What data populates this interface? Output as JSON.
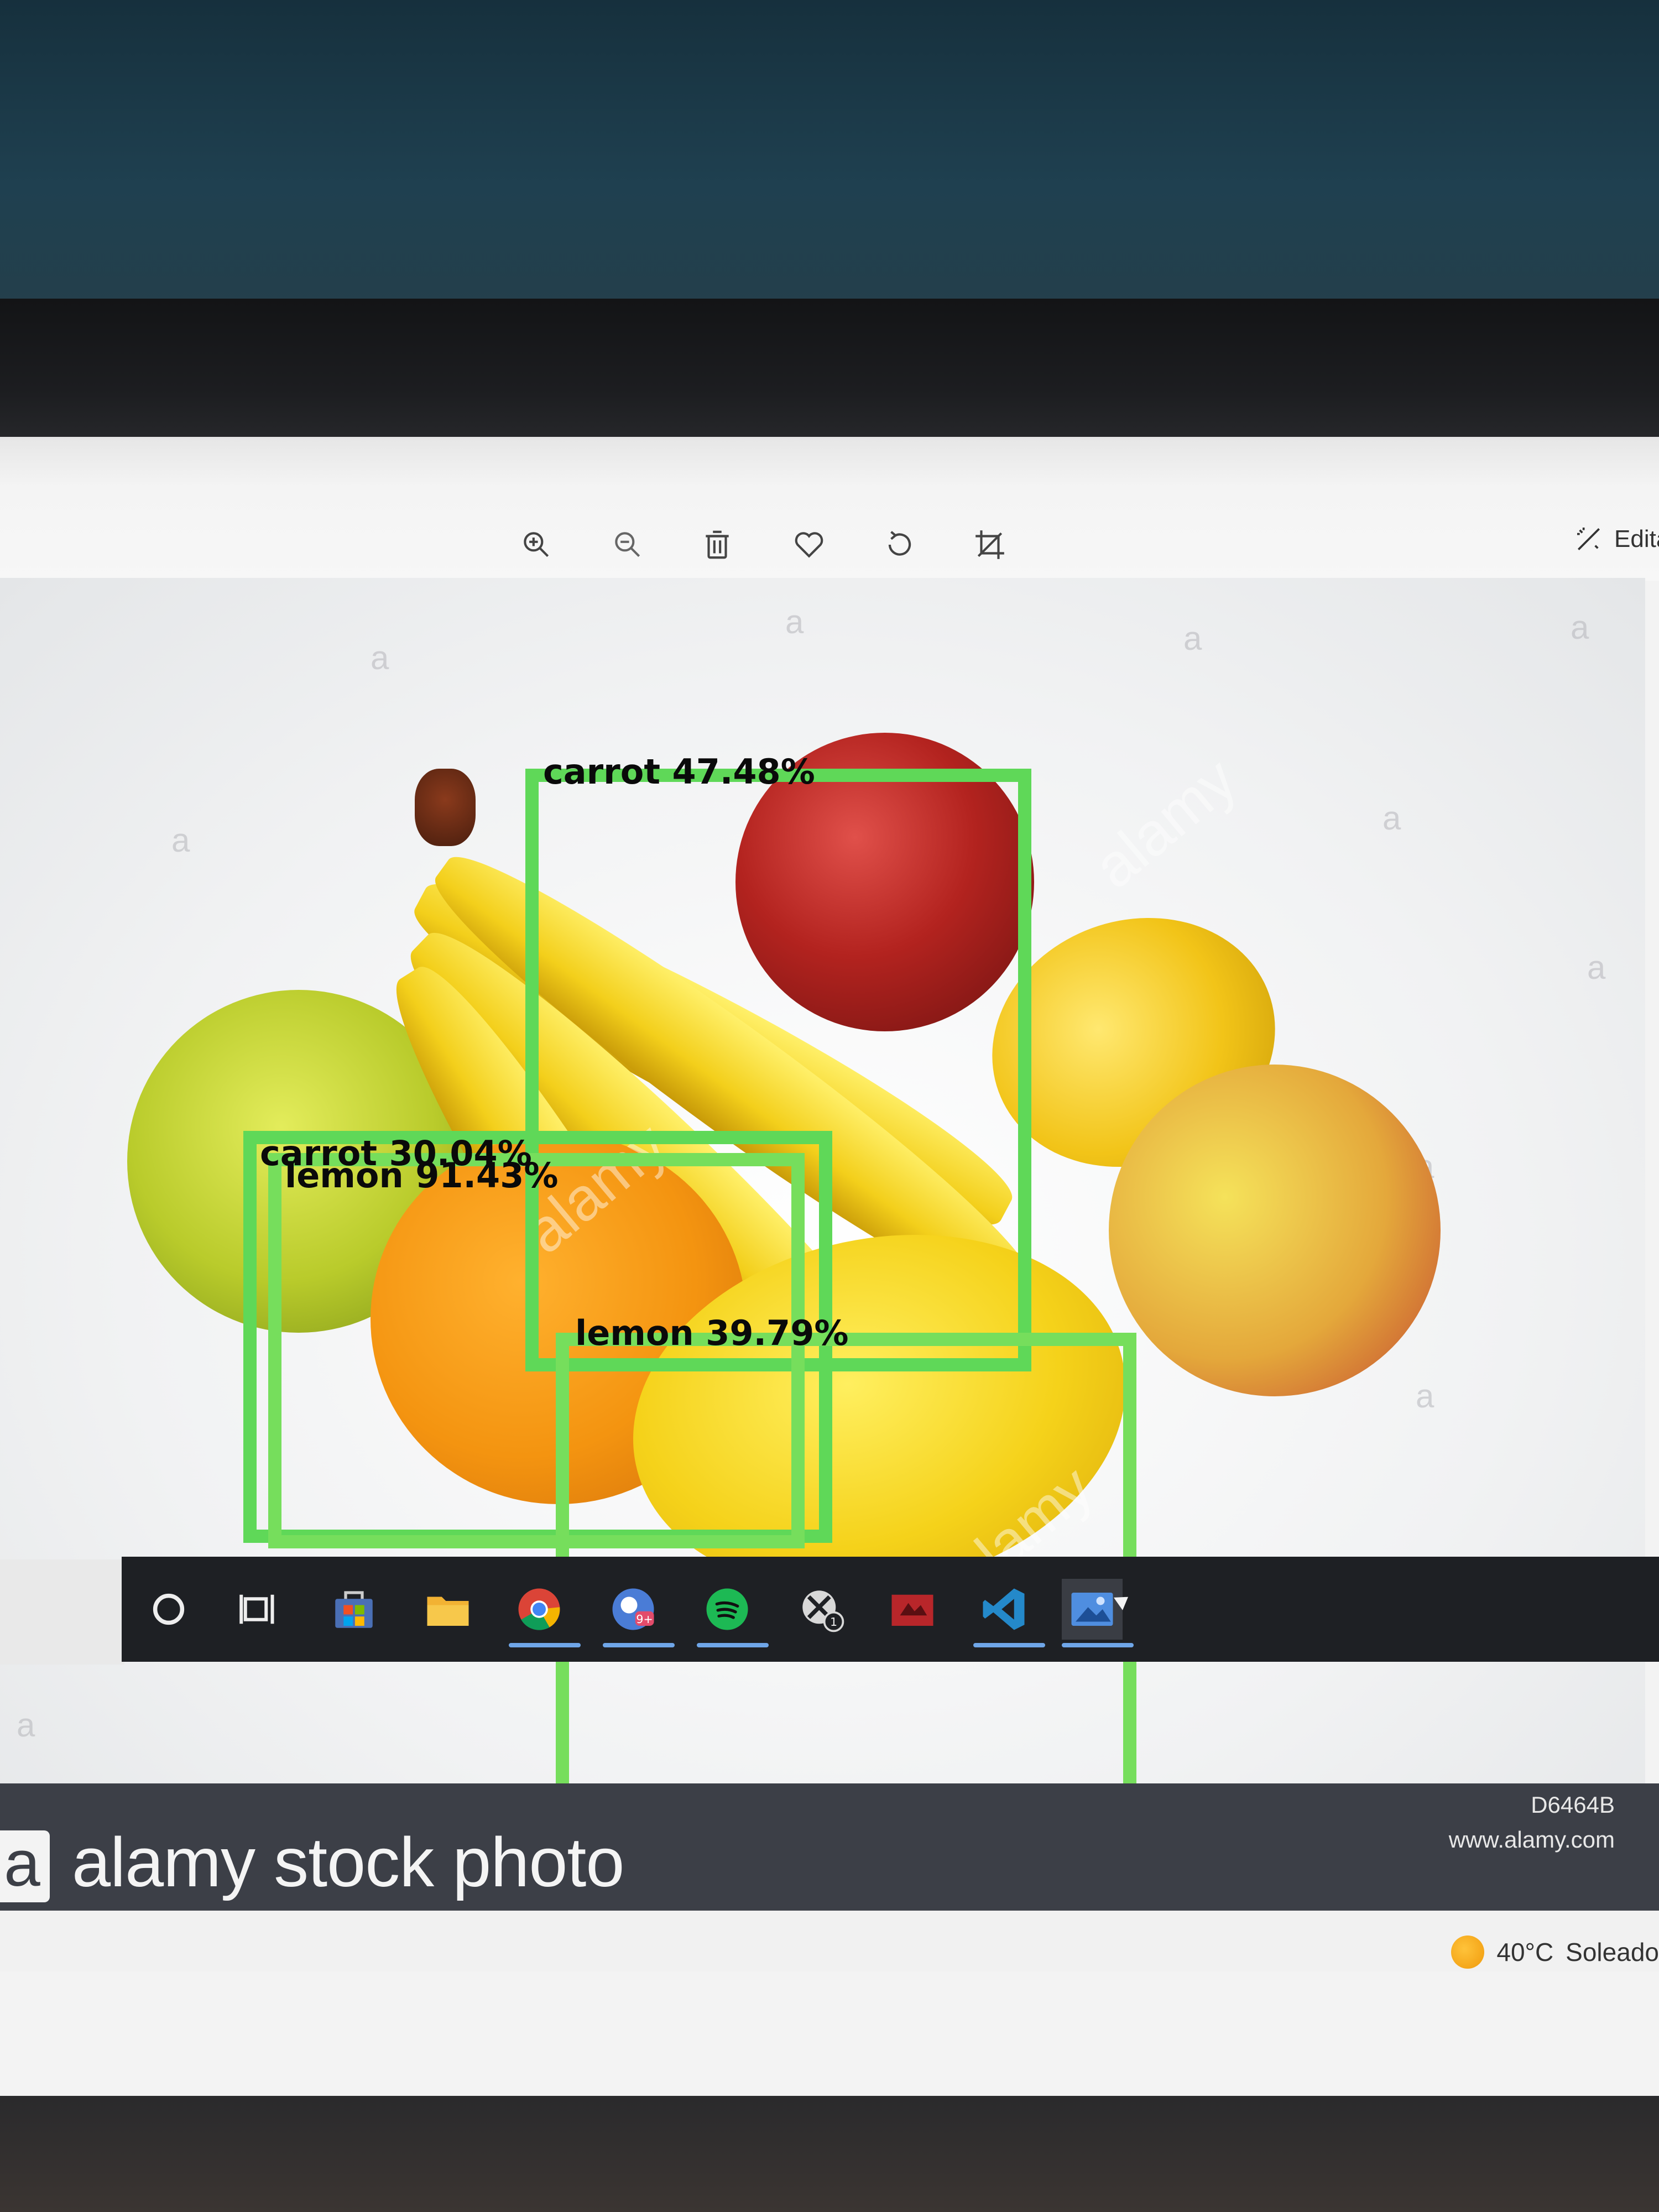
{
  "toolbar": {
    "tools": [
      {
        "name": "zoom-in-icon"
      },
      {
        "name": "zoom-out-icon"
      },
      {
        "name": "delete-icon"
      },
      {
        "name": "favorite-icon"
      },
      {
        "name": "rotate-icon"
      },
      {
        "name": "crop-icon"
      }
    ],
    "edit_label": "Edita"
  },
  "detections": [
    {
      "label": "carrot 47.48%"
    },
    {
      "label": "carrot 30.04%"
    },
    {
      "label": "lemon 91.43%"
    },
    {
      "label": "lemon 39.79%"
    }
  ],
  "watermark": {
    "letter": "a",
    "brand": "alamy"
  },
  "banner": {
    "logo_letter": "a",
    "text": "alamy stock photo",
    "image_id": "D6464B",
    "url": "www.alamy.com"
  },
  "weather": {
    "temperature": "40°C",
    "condition": "Soleado"
  },
  "taskbar": {
    "items": [
      {
        "name": "cortana-icon"
      },
      {
        "name": "task-view-icon"
      },
      {
        "name": "store-icon"
      },
      {
        "name": "file-explorer-icon"
      },
      {
        "name": "chrome-icon"
      },
      {
        "name": "chrome-profile-icon",
        "badge": "9+"
      },
      {
        "name": "spotify-icon"
      },
      {
        "name": "xbox-icon",
        "badge": "1"
      },
      {
        "name": "game-app-icon"
      },
      {
        "name": "vscode-icon"
      },
      {
        "name": "photos-icon"
      }
    ]
  },
  "colors": {
    "detection_box": "#5fd858",
    "detection_box_light": "#76de5c",
    "banner_bg": "#3c3f47",
    "taskbar_bg": "#1e2024",
    "accent_underline": "#6fa6e8"
  }
}
